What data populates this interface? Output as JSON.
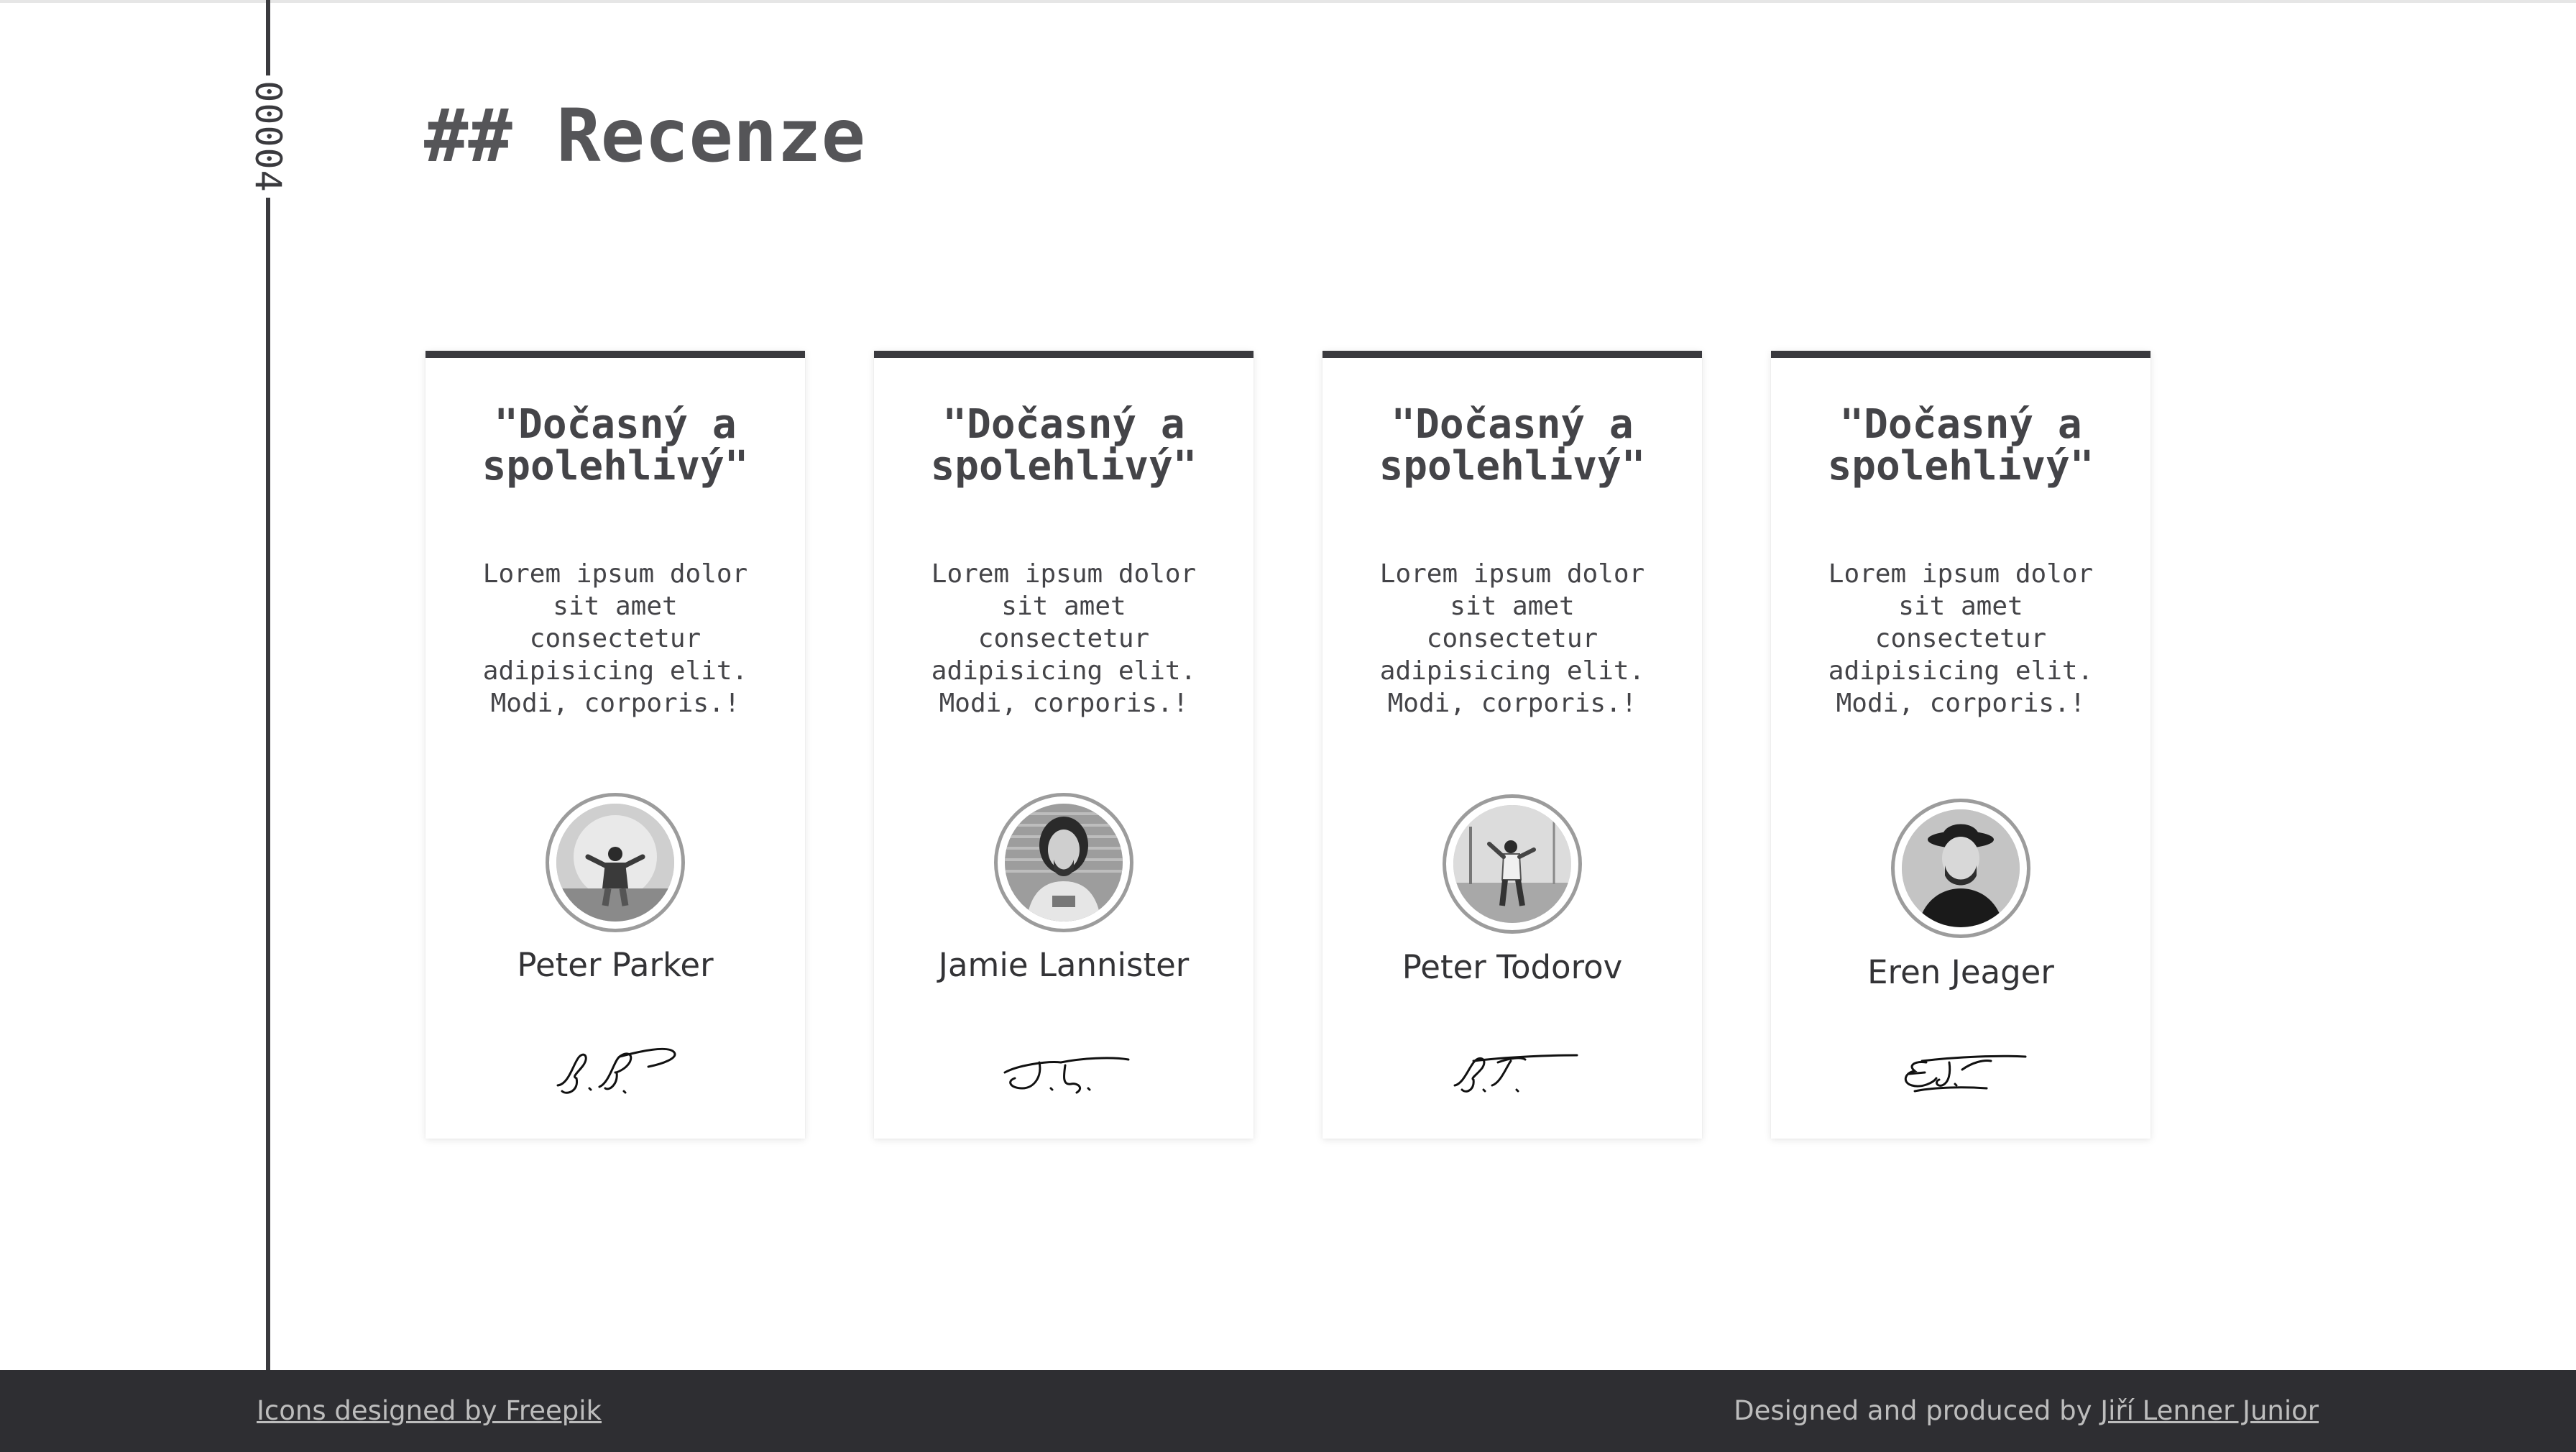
{
  "section": {
    "number": "00004",
    "title": "## Recenze"
  },
  "reviews": [
    {
      "title": "\"Dočasný a spolehlivý\"",
      "text": "Lorem ipsum dolor sit amet consectetur adipisicing elit. Modi, corporis.!",
      "name": "Peter Parker",
      "signature": "P.P."
    },
    {
      "title": "\"Dočasný a spolehlivý\"",
      "text": "Lorem ipsum dolor sit amet consectetur adipisicing elit. Modi, corporis.!",
      "name": "Jamie Lannister",
      "signature": "J.L."
    },
    {
      "title": "\"Dočasný a spolehlivý\"",
      "text": "Lorem ipsum dolor sit amet consectetur adipisicing elit. Modi, corporis.!",
      "name": "Peter Todorov",
      "signature": "P.T."
    },
    {
      "title": "\"Dočasný a spolehlivý\"",
      "text": "Lorem ipsum dolor sit amet consectetur adipisicing elit. Modi, corporis.!",
      "name": "Eren Jeager",
      "signature": "E.J."
    }
  ],
  "footer": {
    "left_link": "Icons designed by Freepik",
    "right_prefix": "Designed and produced by ",
    "right_link": "Jiří Lenner Junior"
  },
  "colors": {
    "dark": "#2e2e32",
    "line": "#3a3a3e",
    "text": "#444448",
    "footer_text": "#bdbdbd"
  }
}
